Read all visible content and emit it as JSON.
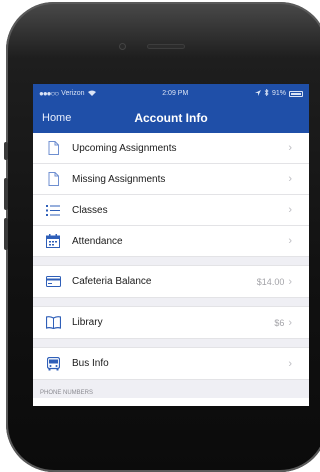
{
  "status_bar": {
    "carrier": "Verizon",
    "time": "2:09 PM",
    "battery": "91%"
  },
  "nav": {
    "back_label": "Home",
    "title": "Account Info"
  },
  "menu": {
    "upcoming": {
      "label": "Upcoming Assignments"
    },
    "missing": {
      "label": "Missing Assignments"
    },
    "classes": {
      "label": "Classes"
    },
    "attendance": {
      "label": "Attendance"
    },
    "cafeteria": {
      "label": "Cafeteria Balance",
      "value": "$14.00"
    },
    "library": {
      "label": "Library",
      "value": "$6"
    },
    "bus": {
      "label": "Bus Info"
    }
  },
  "sections": {
    "phone_numbers": "PHONE NUMBERS"
  },
  "colors": {
    "nav_blue": "#1f4fa8",
    "icon_blue": "#2f5fb8"
  },
  "icons": {
    "document": "document-icon",
    "list": "list-icon",
    "calendar": "calendar-icon",
    "card": "credit-card-icon",
    "book": "book-icon",
    "bus": "bus-icon",
    "chevron": "chevron-right-icon"
  }
}
